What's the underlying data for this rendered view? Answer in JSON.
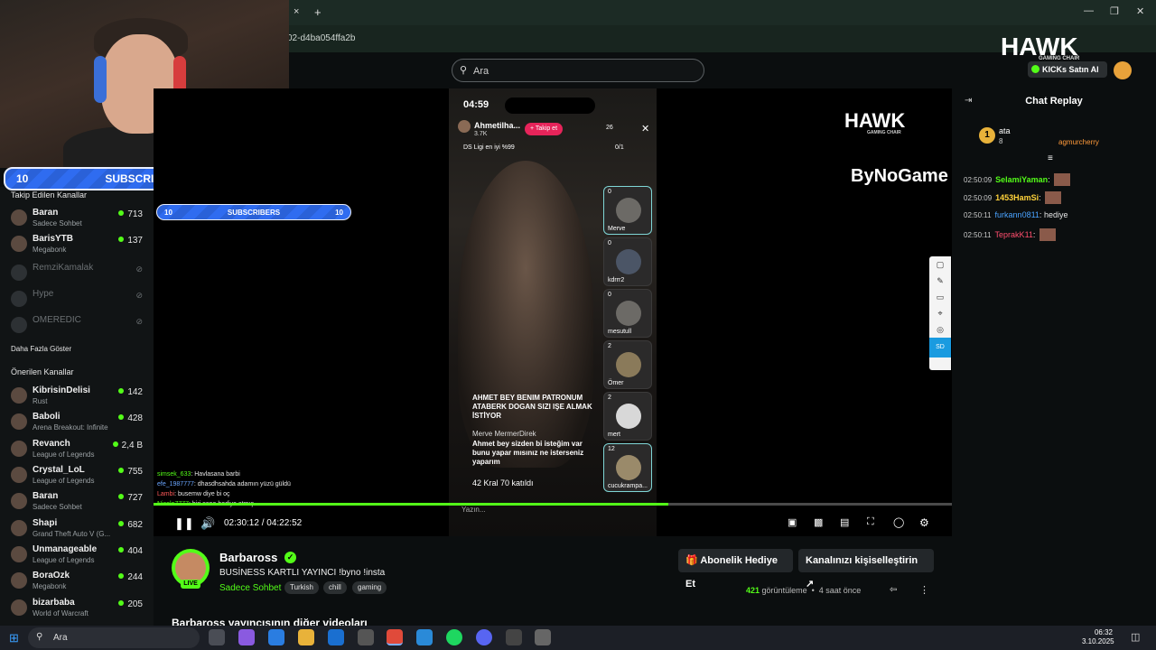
{
  "browser": {
    "url": "02-d4ba054ffa2b",
    "tab_close": "×",
    "tab_add": "+",
    "win_min": "—",
    "win_max": "❐",
    "win_close": "✕"
  },
  "site": {
    "search_placeholder": "Ara",
    "kicks_button": "KICKs Satın Al"
  },
  "overlay": {
    "subs_left": "10",
    "subs_label": "SUBSCRIBERS",
    "subs_right": "10",
    "hawk": "HAWK",
    "hawk_sub": "GAMING CHAIR",
    "bynogame": "ByNoGame"
  },
  "sidebar": {
    "followed_header": "Takip Edilen Kanallar",
    "followed": [
      {
        "name": "Baran",
        "sub": "Sadece Sohbet",
        "count": "713",
        "live": true
      },
      {
        "name": "BarisYTB",
        "sub": "Megabonk",
        "count": "137",
        "live": true
      },
      {
        "name": "RemziKamalak",
        "sub": "",
        "count": "",
        "live": false
      },
      {
        "name": "Hype",
        "sub": "",
        "count": "",
        "live": false
      },
      {
        "name": "OMEREDIC",
        "sub": "",
        "count": "",
        "live": false
      }
    ],
    "show_more": "Daha Fazla Göster",
    "recommended_header": "Önerilen Kanallar",
    "recommended": [
      {
        "name": "KibrisinDelisi",
        "sub": "Rust",
        "count": "142"
      },
      {
        "name": "Baboli",
        "sub": "Arena Breakout: Infinite",
        "count": "428"
      },
      {
        "name": "Revanch",
        "sub": "League of Legends",
        "count": "2,4 B"
      },
      {
        "name": "Crystal_LoL",
        "sub": "League of Legends",
        "count": "755"
      },
      {
        "name": "Baran",
        "sub": "Sadece Sohbet",
        "count": "727"
      },
      {
        "name": "Shapi",
        "sub": "Grand Theft Auto V (G...",
        "count": "682"
      },
      {
        "name": "Unmanageable",
        "sub": "League of Legends",
        "count": "404"
      },
      {
        "name": "BoraOzk",
        "sub": "Megabonk",
        "count": "244"
      },
      {
        "name": "bizarbaba",
        "sub": "World of Warcraft",
        "count": "205"
      }
    ]
  },
  "phone": {
    "time": "04:59",
    "host": "Ahmetilha...",
    "host_likes": "3.7K",
    "follow": "+ Takip et",
    "viewers": "26",
    "league": "DS Ligi en iyi %99",
    "gift_count": "0/1",
    "tiles": [
      {
        "n": "0",
        "label": "Merve"
      },
      {
        "n": "0",
        "label": "kdrrr2"
      },
      {
        "n": "0",
        "label": "mesutull"
      },
      {
        "n": "2",
        "label": "Ömer"
      },
      {
        "n": "2",
        "label": "mert"
      },
      {
        "n": "12",
        "label": "cucukrampa..."
      }
    ],
    "comment1": "AHMET BEY BENIM PATRONUM ATABERK DOGAN SIZI IŞE ALMAK İSTİYOR",
    "comment2_user": "Merve MermerDirek",
    "comment2": "Ahmet bey sizden bi isteğim var bunu yapar mısınız ne isterseniz yaparım",
    "joined": "42 Kral 70 katıldı",
    "input": "Yazın..."
  },
  "overlay_chat": [
    {
      "user": "simsek_633",
      "text": "Havlasana barbi",
      "color": "#53fc18"
    },
    {
      "user": "efe_1987777",
      "text": "dhasdhsahda adamın yüzü güldü",
      "color": "#6aa6ff"
    },
    {
      "user": "Lambi",
      "text": "busemw diye bi oç",
      "color": "#ff5a5a"
    },
    {
      "user": "Nicolo7777",
      "text": "biri sana hediye atmış",
      "color": "#53fc18"
    }
  ],
  "player": {
    "time_current": "02:30:12",
    "time_sep": "/",
    "time_total": "04:22:52",
    "progress": 0.645
  },
  "tools": {
    "sd": "SD"
  },
  "chat": {
    "title": "Chat Replay",
    "top_user": "ata",
    "top_rank": "1",
    "top_num": "8",
    "top_user2": "agmurcherry",
    "messages": [
      {
        "ts": "02:50:09",
        "user": "SelamiYaman",
        "text": "",
        "color": "#53fc18"
      },
      {
        "ts": "02:50:09",
        "user": "1453HamSi",
        "text": "",
        "color": "#ffd23a"
      },
      {
        "ts": "02:50:11",
        "user": "furkann0811",
        "text": "hediye",
        "color": "#4aa3ff"
      },
      {
        "ts": "02:50:11",
        "user": "TeprakK11",
        "text": "",
        "color": "#ff4d6d"
      }
    ]
  },
  "channel": {
    "name": "Barbaross",
    "live": "LIVE",
    "title": "BUSİNESS KARTLI YAYINCI  !byno !insta",
    "category": "Sadece Sohbet",
    "tags": [
      "Turkish",
      "chill",
      "gaming"
    ],
    "gift_button": "Abonelik Hediye Et",
    "customize_button": "Kanalınızı kişiselleştirin",
    "views": "421",
    "views_label": "görüntüleme",
    "ago": "4 saat önce",
    "more_videos": "Barbaross yayıncısının diğer videoları"
  },
  "taskbar": {
    "search": "Ara",
    "time": "06:32",
    "date": "3.10.2025"
  },
  "colors": {
    "accent": "#53fc18",
    "bg": "#0b0e0f",
    "sidebar": "#111415"
  }
}
